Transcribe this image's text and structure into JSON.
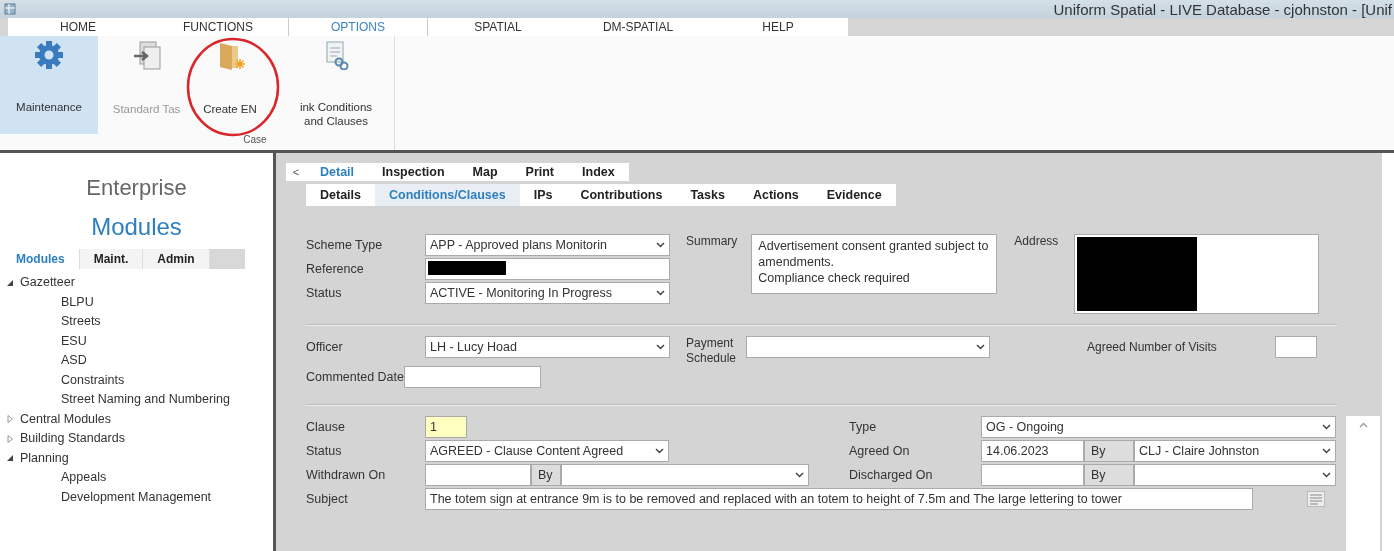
{
  "window": {
    "title": "Uniform Spatial - LIVE Database - cjohnston - [Unif"
  },
  "ribbon": {
    "tabs": [
      {
        "label": "HOME",
        "selected": false
      },
      {
        "label": "FUNCTIONS",
        "selected": false
      },
      {
        "label": "OPTIONS",
        "selected": true
      },
      {
        "label": "SPATIAL",
        "selected": false
      },
      {
        "label": "DM-SPATIAL",
        "selected": false
      },
      {
        "label": "HELP",
        "selected": false
      }
    ],
    "buttons": [
      {
        "label": "Maintenance",
        "kind": "gear",
        "selected": true,
        "disabled": false
      },
      {
        "label": "Standard Tas",
        "kind": "task",
        "selected": false,
        "disabled": true
      },
      {
        "label": "Create EN",
        "kind": "create",
        "selected": false,
        "disabled": false
      },
      {
        "label": "ink Conditions\nand Clauses",
        "kind": "link",
        "selected": false,
        "disabled": false
      }
    ],
    "group_label": "Case",
    "highlight_circle": true
  },
  "sidebar": {
    "title": "Enterprise",
    "subtitle": "Modules",
    "tabs": [
      {
        "label": "Modules",
        "selected": true
      },
      {
        "label": "Maint.",
        "selected": false
      },
      {
        "label": "Admin",
        "selected": false
      }
    ],
    "tree": [
      {
        "label": "Gazetteer",
        "expanded": true,
        "children": [
          {
            "label": "BLPU"
          },
          {
            "label": "Streets"
          },
          {
            "label": "ESU"
          },
          {
            "label": "ASD"
          },
          {
            "label": "Constraints"
          },
          {
            "label": "Street Naming and Numbering"
          }
        ]
      },
      {
        "label": "Central Modules",
        "expanded": false
      },
      {
        "label": "Building Standards",
        "expanded": false
      },
      {
        "label": "Planning",
        "expanded": true,
        "children": [
          {
            "label": "Appeals"
          },
          {
            "label": "Development Management"
          }
        ]
      }
    ]
  },
  "collapse_button": "<",
  "detail_tabs": [
    {
      "label": "Detail",
      "selected": true
    },
    {
      "label": "Inspection",
      "selected": false
    },
    {
      "label": "Map",
      "selected": false
    },
    {
      "label": "Print",
      "selected": false
    },
    {
      "label": "Index",
      "selected": false
    }
  ],
  "sub_tabs": [
    {
      "label": "Details",
      "selected": false
    },
    {
      "label": "Conditions/Clauses",
      "selected": true
    },
    {
      "label": "IPs",
      "selected": false
    },
    {
      "label": "Contributions",
      "selected": false
    },
    {
      "label": "Tasks",
      "selected": false
    },
    {
      "label": "Actions",
      "selected": false
    },
    {
      "label": "Evidence",
      "selected": false
    }
  ],
  "form": {
    "scheme_type": {
      "label": "Scheme Type",
      "kind": "select",
      "value": "APP - Approved plans Monitorin"
    },
    "reference": {
      "label": "Reference",
      "kind": "input",
      "redacted": true
    },
    "status": {
      "label": "Status",
      "kind": "select",
      "value": "ACTIVE - Monitoring In Progress"
    },
    "summary": {
      "label": "Summary",
      "kind": "textarea",
      "value": "Advertisement consent granted subject to amendments.\nCompliance check required"
    },
    "address": {
      "label": "Address",
      "kind": "textarea",
      "redacted": true
    },
    "officer": {
      "label": "Officer",
      "kind": "select",
      "value": "LH - Lucy Hoad"
    },
    "payment_schedule": {
      "label": "Payment Schedule",
      "kind": "select"
    },
    "agreed_visits": {
      "label": "Agreed Number of Visits",
      "kind": "input"
    },
    "commented_date": {
      "label": "Commented Date",
      "kind": "input"
    }
  },
  "clause": {
    "clause": {
      "label": "Clause",
      "kind": "input",
      "value": "1",
      "highlighted": true
    },
    "type": {
      "label": "Type",
      "kind": "select",
      "value": "OG - Ongoing"
    },
    "status": {
      "label": "Status",
      "kind": "select",
      "value": "AGREED - Clause Content Agreed"
    },
    "agreed_on": {
      "label": "Agreed On",
      "kind": "input",
      "value": "14.06.2023"
    },
    "agreed_by": {
      "label": "By",
      "kind": "select",
      "value": "CLJ - Claire Johnston"
    },
    "withdrawn_on": {
      "label": "Withdrawn On",
      "kind": "input"
    },
    "withdrawn_by": {
      "label": "By",
      "kind": "select"
    },
    "discharged_on": {
      "label": "Discharged On",
      "kind": "input"
    },
    "discharged_by": {
      "label": "By",
      "kind": "select"
    },
    "subject": {
      "label": "Subject",
      "kind": "input",
      "value": "The totem sign at entrance 9m is to be removed and replaced with an totem to height of 7.5m and The large lettering to tower"
    }
  }
}
